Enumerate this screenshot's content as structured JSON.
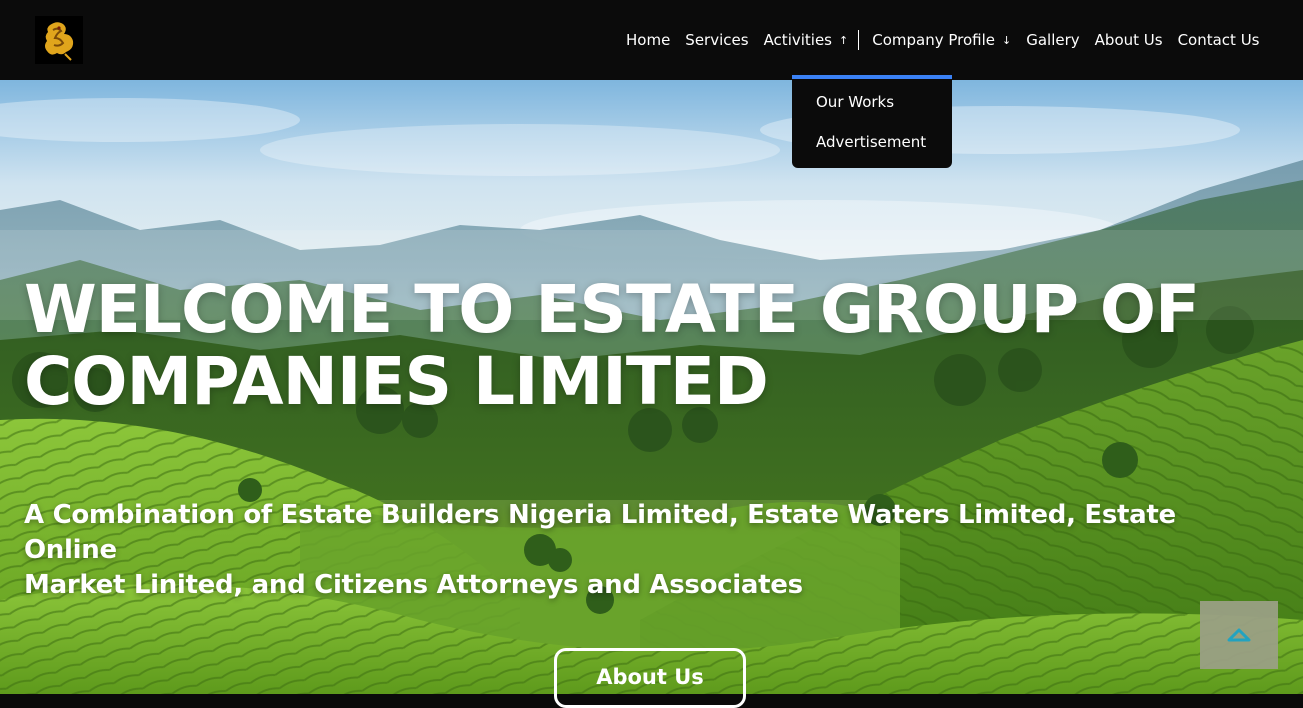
{
  "navbar": {
    "items": [
      {
        "label": "Home"
      },
      {
        "label": "Services"
      },
      {
        "label": "Activities",
        "arrow": "↑"
      },
      {
        "label": "Company Profile",
        "arrow": "↓"
      },
      {
        "label": "Gallery"
      },
      {
        "label": "About Us"
      },
      {
        "label": "Contact Us"
      }
    ]
  },
  "dropdown": {
    "items": [
      "Our Works",
      "Advertisement"
    ],
    "accent_color": "#3b82f6"
  },
  "hero": {
    "title_line1": "WELCOME TO ESTATE GROUP OF",
    "title_line2": "COMPANIES LIMITED",
    "subtitle_line1": "A Combination of Estate Builders Nigeria Limited, Estate Waters Limited, Estate Online",
    "subtitle_line2": "Market Linited, and Citizens Attorneys and Associates",
    "cta_label": "About Us"
  },
  "icons": {
    "logo": "dragon-logo-icon",
    "scroll_top": "chevron-up-icon"
  },
  "colors": {
    "navbar_bg": "#0b0b0b",
    "scroll_top_bg": "#9aa084",
    "scroll_top_icon": "#1fa3c8"
  }
}
